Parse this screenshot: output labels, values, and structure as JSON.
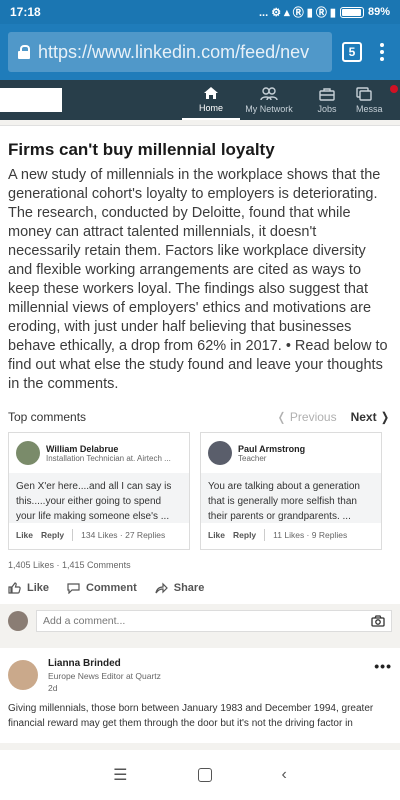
{
  "status_bar": {
    "time": "17:18",
    "icons": "... ⚙ ▴ Ⓡ ▮ Ⓡ ▮",
    "battery_pct": "89%"
  },
  "browser": {
    "url": "https://www.linkedin.com/feed/ne​v",
    "url_display": "https://www.linkedin.com/feed/nev",
    "tab_count": "5"
  },
  "linkedin_nav": {
    "items": [
      {
        "label": "Home",
        "icon": "home-icon"
      },
      {
        "label": "My Network",
        "icon": "network-icon"
      },
      {
        "label": "Jobs",
        "icon": "briefcase-icon"
      },
      {
        "label": "Messa",
        "icon": "messaging-icon"
      }
    ]
  },
  "article": {
    "title": "Firms can't buy millennial loyalty",
    "body": "A new study of millennials in the workplace shows that the generational cohort's loyalty to employers is deteriorating. The research, conducted by Deloitte, found that while money can attract talented millennials, it doesn't necessarily retain them. Factors like workplace diversity and flexible working arrangements are cited as ways to keep these workers loyal. The findings also suggest that millennial views of employers' ethics and motivations are eroding, with just under half believing that businesses behave ethically, a drop from 62% in 2017. • Read below to find out what else the study found and leave your thoughts in the comments."
  },
  "top_comments": {
    "label": "Top comments",
    "prev": "❬  Previous",
    "next": "Next ❭",
    "cards": [
      {
        "name": "William Delabrue",
        "title": "Installation Technician at. Airtech ...",
        "text": "Gen X'er here....and all I can say is this.....your either going to spend your life making someone else's ...",
        "like": "Like",
        "reply": "Reply",
        "meta": "134 Likes · 27 Replies"
      },
      {
        "name": "Paul Armstrong",
        "title": "Teacher",
        "text": "You are talking about a generation that is generally more selfish than their parents or grandparents. ...",
        "like": "Like",
        "reply": "Reply",
        "meta": "11 Likes · 9 Replies"
      }
    ]
  },
  "post_stats": "1,405 Likes · 1,415 Comments",
  "post_actions": {
    "like": "Like",
    "comment": "Comment",
    "share": "Share"
  },
  "add_comment": {
    "placeholder": "Add a comment..."
  },
  "post2": {
    "name": "Lianna Brinded",
    "role": "Europe News Editor at Quartz",
    "age": "2d",
    "more": "•••",
    "text": "Giving millennials, those born between January 1983 and December 1994, greater financial reward may get them through the door but it's not the driving factor in"
  },
  "system_nav": {
    "menu": "☰",
    "home": "",
    "back": "‹"
  }
}
